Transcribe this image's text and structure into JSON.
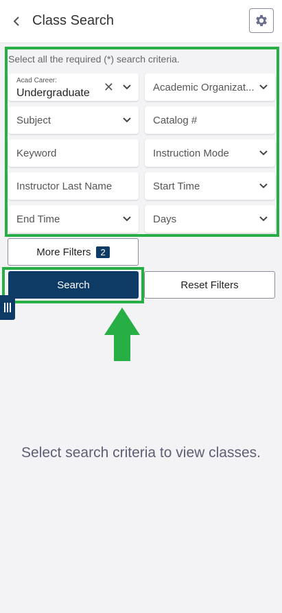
{
  "header": {
    "title": "Class Search",
    "back_icon": "chevron-left-icon",
    "settings_icon": "gear-icon"
  },
  "hint": "Select all the required (*) search criteria.",
  "fields": {
    "acad_career": {
      "label": "Acad Career:",
      "value": "Undergraduate"
    },
    "academic_org": {
      "placeholder": "Academic Organizat..."
    },
    "subject": {
      "placeholder": "Subject"
    },
    "catalog": {
      "placeholder": "Catalog #"
    },
    "keyword": {
      "placeholder": "Keyword"
    },
    "instruction_mode": {
      "placeholder": "Instruction Mode"
    },
    "instructor_last_name": {
      "placeholder": "Instructor Last Name"
    },
    "start_time": {
      "placeholder": "Start Time"
    },
    "end_time": {
      "placeholder": "End Time"
    },
    "days": {
      "placeholder": "Days"
    }
  },
  "buttons": {
    "more_filters": "More Filters",
    "more_filters_count": "2",
    "search": "Search",
    "reset": "Reset Filters"
  },
  "empty_state": "Select search criteria to view classes.",
  "colors": {
    "primary": "#0d3b66",
    "highlight": "#27ae45",
    "background": "#f3f3f6"
  }
}
